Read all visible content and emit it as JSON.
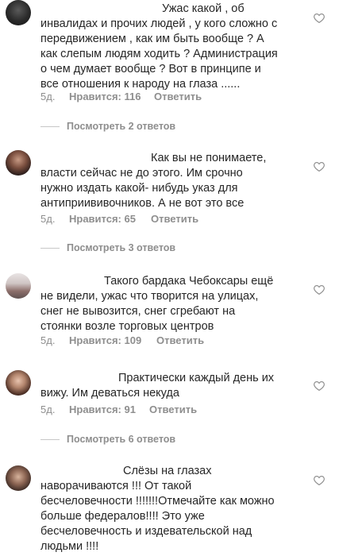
{
  "comments": [
    {
      "lines": [
        "Ужас какой , об",
        "инвалидах и прочих людей , у кого сложно с",
        "передвижением , как им быть вообще ? А",
        "как слепым людям ходить ? Администрация",
        "о чем думает вообще ? Вот в принципе и",
        "все отношения к народу на глаза ......"
      ],
      "ago": "5д.",
      "likes": "Нравится: 116",
      "reply": "Ответить",
      "view_replies": "Посмотреть 2 ответов"
    },
    {
      "lines": [
        "Как вы не понимаете,",
        "власти сейчас не до этого. Им срочно",
        "нужно издать какой- нибудь указ для",
        "антиприививочников. А не вот это все"
      ],
      "ago": "5д.",
      "likes": "Нравится: 65",
      "reply": "Ответить",
      "view_replies": "Посмотреть 3 ответов"
    },
    {
      "lines": [
        "Такого бардака Чебоксары ещё",
        "не видели, ужас что творится на улицах,",
        "снег не вывозится, снег сгребают на",
        "стоянки возле торговых центров"
      ],
      "ago": "5д.",
      "likes": "Нравится: 109",
      "reply": "Ответить",
      "view_replies": ""
    },
    {
      "lines": [
        "Практически каждый день их",
        "вижу. Им деваться некуда"
      ],
      "ago": "5д.",
      "likes": "Нравится: 91",
      "reply": "Ответить",
      "view_replies": "Посмотреть 6 ответов"
    },
    {
      "lines": [
        "Слёзы на глазах",
        "наворачиваются !!! От такой",
        "бесчеловечности !!!!!!!Отмечайте как можно",
        "больше федералов!!!! Это уже",
        "бесчеловечность и издевательской над",
        "людьми !!!!"
      ],
      "ago": "",
      "likes": "",
      "reply": "",
      "view_replies": ""
    }
  ],
  "colors": {
    "text": "#262626",
    "meta": "#8e8e8e",
    "divider": "#c7c7c7"
  },
  "icons": {
    "like": "heart-outline-icon"
  }
}
